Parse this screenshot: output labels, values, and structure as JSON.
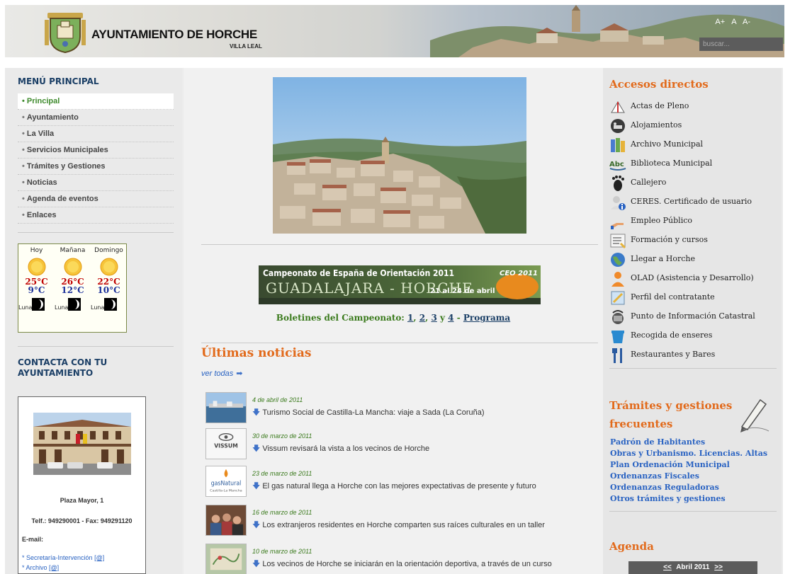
{
  "header": {
    "title": "AYUNTAMIENTO DE HORCHE",
    "subtitle": "VILLA LEAL",
    "font_tools": [
      "A+",
      "A",
      "A-"
    ],
    "search_placeholder": "buscar..."
  },
  "left": {
    "menu_title": "MENÚ PRINCIPAL",
    "menu_items": [
      {
        "label": "Principal",
        "active": true
      },
      {
        "label": "Ayuntamiento"
      },
      {
        "label": "La Villa"
      },
      {
        "label": "Servicios Municipales"
      },
      {
        "label": "Trámites y Gestiones"
      },
      {
        "label": "Noticias"
      },
      {
        "label": "Agenda de eventos"
      },
      {
        "label": "Enlaces"
      }
    ],
    "weather": [
      {
        "day": "Hoy",
        "max": "25°C",
        "min": "9°C",
        "moon": "Luna"
      },
      {
        "day": "Mañana",
        "max": "26°C",
        "min": "12°C",
        "moon": "Luna"
      },
      {
        "day": "Domingo",
        "max": "22°C",
        "min": "10°C",
        "moon": "Luna"
      }
    ],
    "contact_title": "CONTACTA CON TU AYUNTAMIENTO",
    "address": "Plaza Mayor, 1",
    "phone": "Telf.: 949290001 - Fax: 949291120",
    "email_label": "E-mail:",
    "email_links": [
      {
        "text": "Secretaría-Intervención",
        "at": "[@]"
      },
      {
        "text": "Archivo",
        "at": "[@]"
      }
    ]
  },
  "center": {
    "banner_text": {
      "line1": "Campeonato de España de Orientación 2011",
      "line2": "GUADALAJARA - HORCHE",
      "dates": "21 al 24 de abril",
      "badge": "CEO 2011"
    },
    "boletines": {
      "prefix": "Boletines del Campeonato:",
      "n1": "1",
      "n2": "2",
      "n3": "3",
      "y": "y",
      "n4": "4",
      "dash": "-",
      "programa": "Programa"
    },
    "news_title": "Últimas noticias",
    "ver_todas": "ver todas",
    "news": [
      {
        "date": "4 de abril de 2011",
        "headline": "Turismo Social de Castilla-La Mancha: viaje a Sada (La Coruña)"
      },
      {
        "date": "30 de marzo de 2011",
        "headline": "Vissum revisará la vista a los vecinos de Horche",
        "thumb_text": "VISSUM"
      },
      {
        "date": "23 de marzo de 2011",
        "headline": "El gas natural llega a Horche con las mejores expectativas de presente y futuro",
        "thumb_text": "gasNatural",
        "thumb_sub": "Castilla-La Mancha"
      },
      {
        "date": "16 de marzo de 2011",
        "headline": "Los extranjeros residentes en Horche comparten sus raíces culturales en un taller"
      },
      {
        "date": "10 de marzo de 2011",
        "headline": "Los vecinos de Horche se iniciarán en la orientación deportiva, a través de un curso"
      }
    ]
  },
  "right": {
    "accesos_title": "Accesos directos",
    "accesos": [
      {
        "label": "Actas de Pleno",
        "icon": "book-icon"
      },
      {
        "label": "Alojamientos",
        "icon": "bed-icon"
      },
      {
        "label": "Archivo Municipal",
        "icon": "archive-icon"
      },
      {
        "label": "Biblioteca Municipal",
        "icon": "abc-icon"
      },
      {
        "label": "Callejero",
        "icon": "footprint-icon"
      },
      {
        "label": "CERES. Certificado de usuario",
        "icon": "user-info-icon"
      },
      {
        "label": "Empleo Público",
        "icon": "hand-icon"
      },
      {
        "label": "Formación y cursos",
        "icon": "document-icon"
      },
      {
        "label": "Llegar a Horche",
        "icon": "globe-icon"
      },
      {
        "label": "OLAD (Asistencia y Desarrollo)",
        "icon": "person-icon"
      },
      {
        "label": "Perfil del contratante",
        "icon": "profile-icon"
      },
      {
        "label": "Punto de Información Catastral",
        "icon": "satellite-icon"
      },
      {
        "label": "Recogida de enseres",
        "icon": "bin-icon"
      },
      {
        "label": "Restaurantes y Bares",
        "icon": "cutlery-icon"
      }
    ],
    "tramites_title": "Trámites y gestiones frecuentes",
    "tramites": [
      "Padrón de Habitantes",
      "Obras y Urbanismo. Licencias. Altas",
      "Plan Ordenación Municipal",
      "Ordenanzas Fiscales",
      "Ordenanzas Reguladoras",
      "Otros trámites y gestiones"
    ],
    "agenda_title": "Agenda",
    "calendar": {
      "prev": "<<",
      "month": "Abril 2011",
      "next": ">>"
    }
  }
}
